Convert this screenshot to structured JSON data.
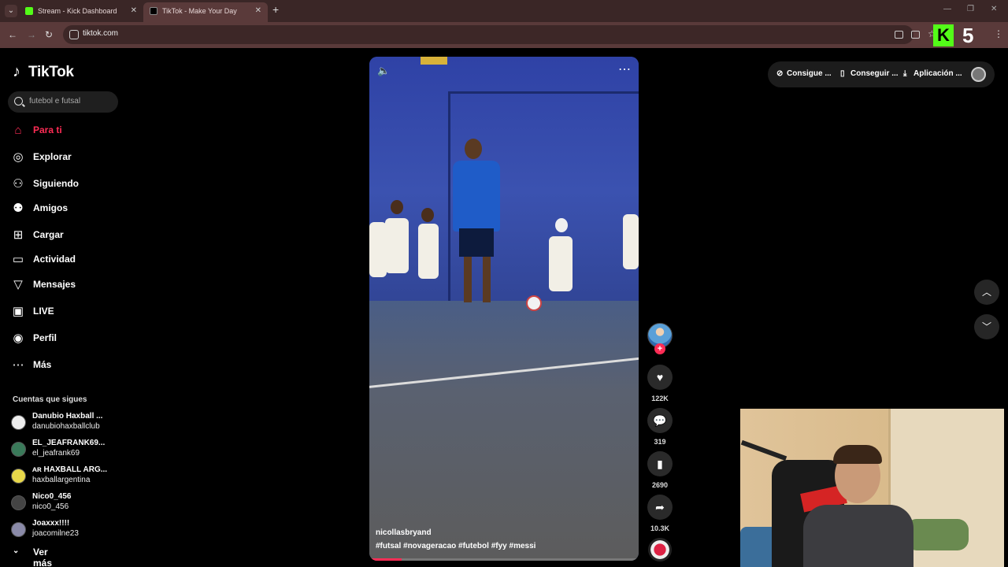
{
  "browser": {
    "tabs": [
      {
        "label": "Stream - Kick Dashboard"
      },
      {
        "label": "TikTok - Make Your Day"
      }
    ],
    "url": "tiktok.com",
    "kick_counter": "5"
  },
  "tiktok": {
    "logo": "TikTok",
    "search_placeholder": "futebol e futsal",
    "nav": [
      {
        "label": "Para ti",
        "icon": "home-icon"
      },
      {
        "label": "Explorar",
        "icon": "compass-icon"
      },
      {
        "label": "Siguiendo",
        "icon": "following-icon"
      },
      {
        "label": "Amigos",
        "icon": "friends-icon"
      },
      {
        "label": "Cargar",
        "icon": "upload-icon"
      },
      {
        "label": "Actividad",
        "icon": "activity-icon"
      },
      {
        "label": "Mensajes",
        "icon": "messages-icon"
      },
      {
        "label": "LIVE",
        "icon": "live-icon"
      },
      {
        "label": "Perfil",
        "icon": "profile-icon"
      },
      {
        "label": "Más",
        "icon": "more-icon"
      }
    ],
    "following_title": "Cuentas que sigues",
    "following": [
      {
        "name": "Danubio Haxball ...",
        "user": "danubiohaxballclub"
      },
      {
        "name": "EL_JEAFRANK69...",
        "user": "el_jeafrank69"
      },
      {
        "name": "ᴀʀ HAXBALL ARG...",
        "user": "haxballargentina"
      },
      {
        "name": "Nico0_456",
        "user": "nico0_456"
      },
      {
        "name": "Joaxxx!!!!",
        "user": "joacomilne23"
      }
    ],
    "ver_mas": "Ver más",
    "video": {
      "author": "nicollasbryand",
      "hashtags": "#futsal #novageracao #futebol #fyy #messi",
      "progress": 0.12
    },
    "actions": {
      "likes": "122K",
      "comments": "319",
      "saves": "2690",
      "shares": "10.3K"
    },
    "topbar": [
      {
        "label": "Consigue ..."
      },
      {
        "label": "Conseguir ..."
      },
      {
        "label": "Aplicación ..."
      }
    ]
  },
  "colors": {
    "accent": "#fe2c55",
    "kick_green": "#53fc18",
    "chrome_bg": "#5a3a3a"
  }
}
